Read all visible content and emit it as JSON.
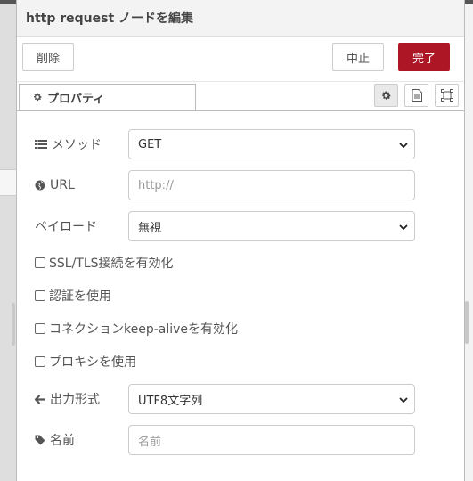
{
  "title": "http request ノードを編集",
  "toolbar": {
    "delete_label": "削除",
    "cancel_label": "中止",
    "done_label": "完了"
  },
  "tab": {
    "label": "プロパティ"
  },
  "tab_icons": [
    "gear-icon",
    "document-icon",
    "frame-icon"
  ],
  "fields": {
    "method": {
      "label": "メソッド",
      "value": "GET",
      "icon": "list-icon"
    },
    "url": {
      "label": "URL",
      "value": "",
      "placeholder": "http://",
      "icon": "globe-icon"
    },
    "payload": {
      "label": "ペイロード",
      "value": "無視"
    },
    "ssl": {
      "label": "SSL/TLS接続を有効化",
      "checked": false
    },
    "auth": {
      "label": "認証を使用",
      "checked": false
    },
    "keepalive": {
      "label": "コネクションkeep-aliveを有効化",
      "checked": false
    },
    "proxy": {
      "label": "プロキシを使用",
      "checked": false
    },
    "output": {
      "label": "出力形式",
      "value": "UTF8文字列",
      "icon": "arrow-left-icon"
    },
    "name": {
      "label": "名前",
      "value": "",
      "placeholder": "名前",
      "icon": "tag-icon"
    }
  },
  "colors": {
    "done_button": "#ad1625"
  }
}
